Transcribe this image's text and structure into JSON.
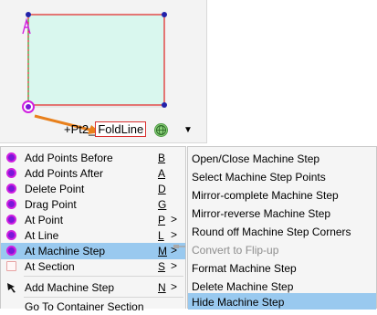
{
  "canvas": {
    "point_label_prefix": "+Pt2_",
    "point_label_fold": "FoldLine",
    "dropdown_glyph": "▼",
    "colors": {
      "fill": "#d9f7ee",
      "outline": "#e02020",
      "guide": "#22aa22",
      "arrow": "#e8801c",
      "vertex": "#2222aa"
    }
  },
  "context_menu": {
    "items": [
      {
        "label": "Add Points Before",
        "shortcut": "B",
        "submenu": false,
        "icon": "magenta-dot-icon"
      },
      {
        "label": "Add Points After",
        "shortcut": "A",
        "submenu": false,
        "icon": "magenta-dot-icon"
      },
      {
        "label": "Delete Point",
        "shortcut": "D",
        "submenu": false,
        "icon": "magenta-dot-icon"
      },
      {
        "label": "Drag Point",
        "shortcut": "G",
        "submenu": false,
        "icon": "magenta-dot-icon"
      },
      {
        "label": "At Point",
        "shortcut": "P",
        "submenu": true,
        "icon": "magenta-dot-icon"
      },
      {
        "label": "At Line",
        "shortcut": "L",
        "submenu": true,
        "icon": "magenta-dot-icon"
      },
      {
        "label": "At Machine Step",
        "shortcut": "M",
        "submenu": true,
        "icon": "magenta-dot-icon",
        "selected": true
      },
      {
        "label": "At Section",
        "shortcut": "S",
        "submenu": true,
        "icon": "section-icon"
      },
      {
        "label": "Add Machine Step",
        "shortcut": "N",
        "submenu": true,
        "icon": "arrow-cursor-icon"
      },
      {
        "label": "Go To Container Section",
        "shortcut": "",
        "submenu": false,
        "icon": ""
      }
    ],
    "submenu_arrow": ">"
  },
  "submenu": {
    "items": [
      {
        "label": "Open/Close Machine Step",
        "disabled": false
      },
      {
        "label": "Select Machine Step Points",
        "disabled": false
      },
      {
        "label": "Mirror-complete Machine Step",
        "disabled": false
      },
      {
        "label": "Mirror-reverse Machine Step",
        "disabled": false
      },
      {
        "label": "Round off Machine Step Corners",
        "disabled": false
      },
      {
        "label": "Convert to Flip-up",
        "disabled": true
      },
      {
        "label": "Format Machine Step",
        "disabled": false
      },
      {
        "label": "Delete Machine Step",
        "disabled": false
      },
      {
        "label": "Hide Machine Step",
        "disabled": false,
        "selected": true
      }
    ]
  }
}
